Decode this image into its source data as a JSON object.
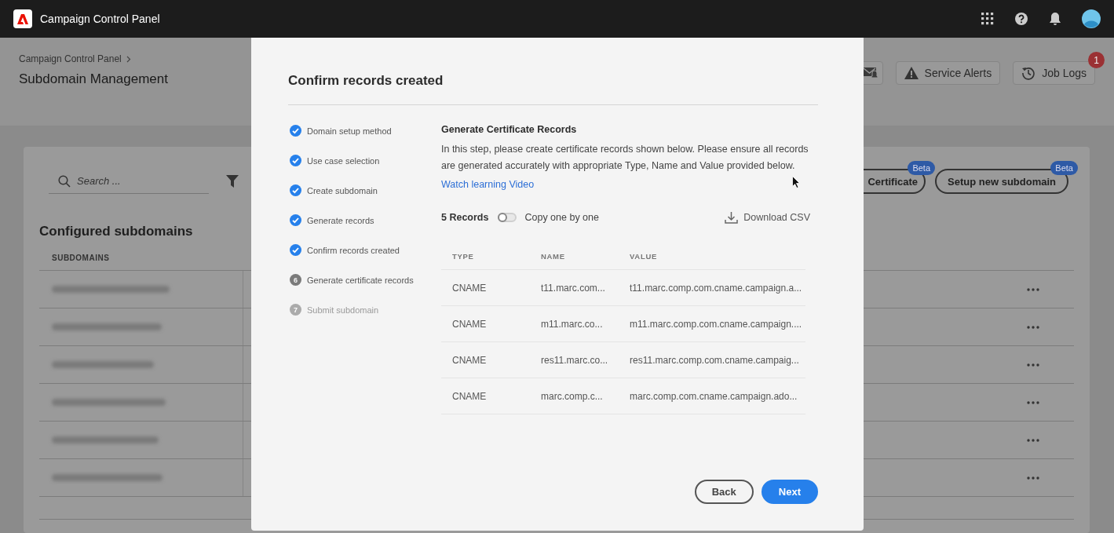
{
  "app_bar": {
    "title": "Campaign Control Panel"
  },
  "page": {
    "breadcrumb": [
      "Campaign Control Panel"
    ],
    "title": "Subdomain Management",
    "header_buttons": [
      {
        "kind": "mail"
      },
      {
        "kind": "alerts",
        "label": "Service Alerts"
      },
      {
        "kind": "logs",
        "label": "Job Logs",
        "badge": "1"
      }
    ]
  },
  "subdomains_panel": {
    "search": {
      "placeholder": "Search ..."
    },
    "actions": [
      {
        "label": "Certificate",
        "badge": "Beta"
      },
      {
        "label": "Setup new subdomain",
        "badge": "Beta"
      }
    ],
    "title": "Configured subdomains",
    "columns": [
      "SUBDOMAINS"
    ],
    "rows": [
      {
        "kind": "blurred"
      },
      {
        "kind": "blurred"
      },
      {
        "kind": "blurred"
      },
      {
        "kind": "blurred"
      },
      {
        "kind": "blurred"
      },
      {
        "kind": "blurred"
      },
      {
        "kind": "empty"
      }
    ]
  },
  "dialog": {
    "title": "Confirm records created",
    "steps": [
      {
        "label": "Domain setup method",
        "completed": true,
        "disabled": false
      },
      {
        "label": "Use case selection",
        "completed": true,
        "disabled": false
      },
      {
        "label": "Create subdomain",
        "completed": true,
        "disabled": false
      },
      {
        "label": "Generate records",
        "completed": true,
        "disabled": false
      },
      {
        "label": "Confirm records created",
        "completed": true,
        "disabled": false
      },
      {
        "label": "Generate certificate records",
        "completed": false,
        "disabled": false,
        "number": "6"
      },
      {
        "label": "Submit subdomain",
        "completed": false,
        "disabled": true,
        "number": "7"
      }
    ],
    "section": {
      "heading": "Generate Certificate Records",
      "description": "In this step, please create certificate records shown below. Please ensure all records are generated accurately with appropriate Type, Name and Value provided below.",
      "link": "Watch learning Video",
      "record_count": "5 Records",
      "copy_toggle": {
        "label": "Copy one by one",
        "on": false
      },
      "download": "Download CSV",
      "columns": [
        "TYPE",
        "NAME",
        "VALUE"
      ],
      "rows": [
        {
          "type": "CNAME",
          "name": "t11.marc.com...",
          "value": "t11.marc.comp.com.cname.campaign.a..."
        },
        {
          "type": "CNAME",
          "name": "m11.marc.co...",
          "value": "m11.marc.comp.com.cname.campaign...."
        },
        {
          "type": "CNAME",
          "name": "res11.marc.co...",
          "value": "res11.marc.comp.com.cname.campaig..."
        },
        {
          "type": "CNAME",
          "name": "marc.comp.c...",
          "value": "marc.comp.com.cname.campaign.ado..."
        }
      ]
    },
    "buttons": [
      {
        "label": "Back",
        "kind": "secondary"
      },
      {
        "label": "Next",
        "kind": "primary"
      }
    ]
  }
}
